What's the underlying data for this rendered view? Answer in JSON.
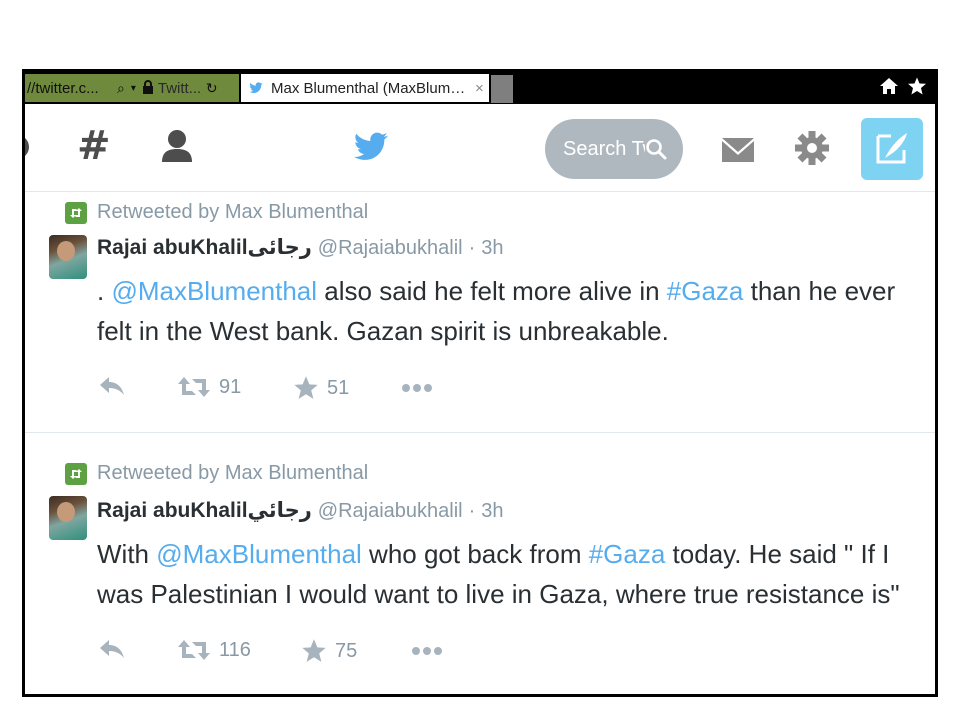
{
  "browser": {
    "address_text": "//twitter.c...",
    "prev_tab_title": "Twitt...",
    "active_tab_title": "Max Blumenthal (MaxBlumen...",
    "close_glyph": "×"
  },
  "header": {
    "search_placeholder": "Search Tw"
  },
  "colors": {
    "twitter_blue": "#55acee",
    "retweet_green": "#5da143",
    "muted": "#8899a6",
    "compose_bg": "#7fd3f2"
  },
  "tweets": [
    {
      "retweeted_by": "Retweeted by Max Blumenthal",
      "name": "Rajai abuKhalilرجائى",
      "handle": "@Rajaiabukhalil",
      "separator": "·",
      "time": "3h",
      "line1_a": ". ",
      "line1_mention": "@MaxBlumenthal",
      "line1_b": " also said he felt more alive in ",
      "line1_hashtag": "#Gaza",
      "line1_c": " than he ever",
      "line2": "felt in the West bank. Gazan spirit is unbreakable.",
      "retweets": "91",
      "favorites": "51"
    },
    {
      "retweeted_by": "Retweeted by Max Blumenthal",
      "name": "Rajai abuKhalilرجائي",
      "handle": "@Rajaiabukhalil",
      "separator": "·",
      "time": "3h",
      "line1_a": "With ",
      "line1_mention": "@MaxBlumenthal",
      "line1_b": " who got back from ",
      "line1_hashtag": "#Gaza",
      "line1_c": " today. He said \" If I",
      "line2": "was Palestinian I would want to live in Gaza, where true resistance is\"",
      "retweets": "116",
      "favorites": "75"
    }
  ]
}
